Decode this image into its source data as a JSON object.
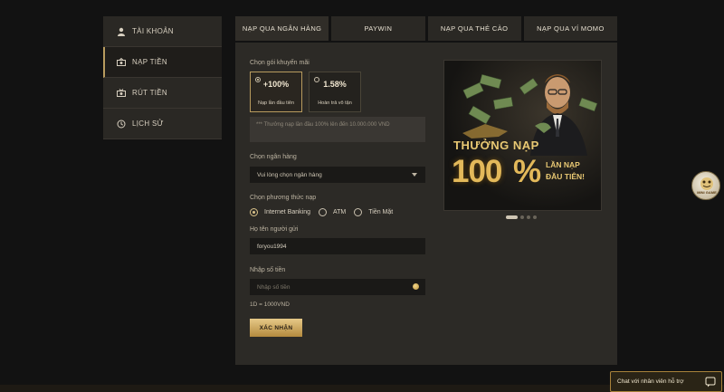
{
  "sidebar": {
    "items": [
      {
        "label": "TÀI KHOẢN",
        "icon": "user-icon"
      },
      {
        "label": "NẠP TIỀN",
        "icon": "deposit-icon"
      },
      {
        "label": "RÚT TIỀN",
        "icon": "withdraw-icon"
      },
      {
        "label": "LỊCH SỬ",
        "icon": "history-icon"
      }
    ],
    "active_index": 1
  },
  "tabs": [
    {
      "label": "NẠP QUA NGÂN HÀNG"
    },
    {
      "label": "PAYWIN"
    },
    {
      "label": "NẠP QUA THẺ CÀO"
    },
    {
      "label": "NẠP QUA VÍ MOMO"
    }
  ],
  "form": {
    "promo_label": "Chọn gói khuyến mãi",
    "promos": [
      {
        "value": "+100%",
        "sub": "Nạp lần đầu tiên",
        "selected": true
      },
      {
        "value": "1.58%",
        "sub": "Hoàn trả vô tận",
        "selected": false
      }
    ],
    "promo_note": "*** Thưởng nạp lần đầu 100% lên đến 10.000.000 VND",
    "bank_label": "Chọn ngân hàng",
    "bank_value": "Vui lòng chọn ngân hàng",
    "method_label": "Chọn phương thức nạp",
    "methods": [
      {
        "label": "Internet Banking",
        "checked": true
      },
      {
        "label": "ATM",
        "checked": false
      },
      {
        "label": "Tiền Mặt",
        "checked": false
      }
    ],
    "sender_label": "Họ tên người gửi",
    "sender_value": "foryou1994",
    "amount_label": "Nhập số tiền",
    "amount_placeholder": "Nhập số tiền",
    "rate": "1D = 1000VND",
    "submit_label": "XÁC NHẬN"
  },
  "banner": {
    "title": "THƯỞNG NẠP",
    "big": "100",
    "pct": "%",
    "line1": "LẦN NẠP",
    "line2": "ĐẦU TIÊN!",
    "slides": 4,
    "active_slide": 0
  },
  "floating_button": {
    "text": "MINI GAME"
  },
  "chat": {
    "label": "Chat với nhân viên hỗ trợ"
  },
  "colors": {
    "accent": "#b89b5e",
    "gold": "#e3b95a",
    "panel": "#2c2a26",
    "bg": "#121212"
  }
}
